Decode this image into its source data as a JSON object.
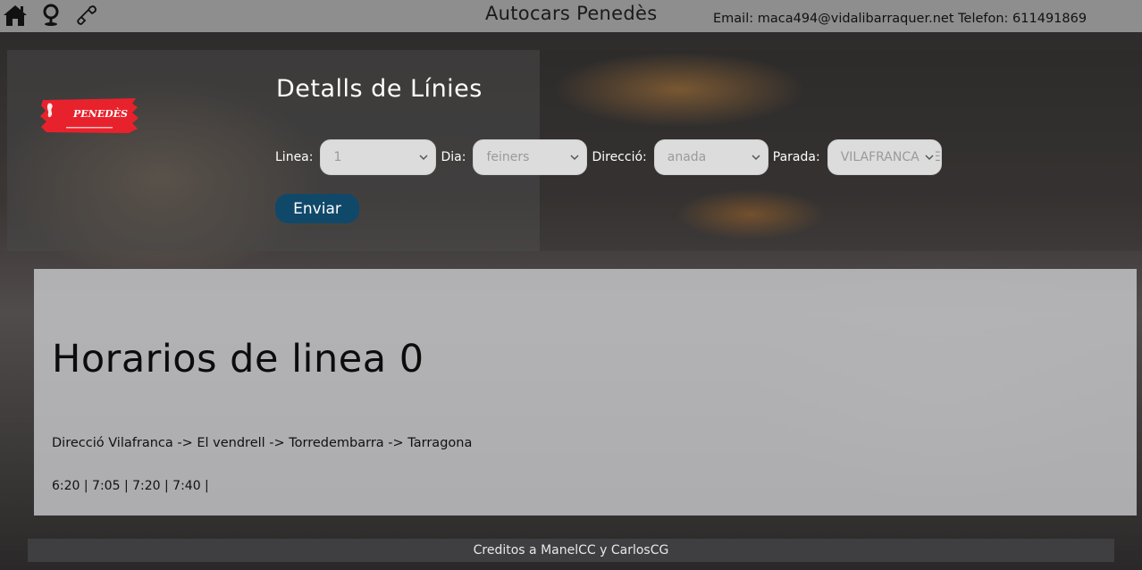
{
  "header": {
    "brand": "Autocars Penedès",
    "contact": "Email: maca494@vidalibarraquer.net Telefon: 611491869",
    "icons": [
      "home-icon",
      "location-pin-icon",
      "phone-icon"
    ]
  },
  "logo": {
    "text": "PENEDÈS"
  },
  "form": {
    "title": "Detalls de Línies",
    "linea_label": "Linea:",
    "linea_value": "1",
    "dia_label": "Dia:",
    "dia_value": "feiners",
    "direccio_label": "Direcció:",
    "direccio_value": "anada",
    "parada_label": "Parada:",
    "parada_value": "VILAFRANCA DEL PENEDÈS",
    "submit_label": "Enviar"
  },
  "schedule": {
    "title": "Horarios de linea 0",
    "route": "Direcció Vilafranca -> El vendrell -> Torredembarra -> Tarragona",
    "times": "6:20 | 7:05 | 7:20 | 7:40 |"
  },
  "footer": {
    "credits": "Creditos a ManelCC y CarlosCG"
  },
  "colors": {
    "topbar": "#8e8e8e",
    "button": "#10486a",
    "select_bg": "#dcdcdc",
    "footer_bg": "#3f3f41",
    "logo_red": "#e8222c"
  }
}
